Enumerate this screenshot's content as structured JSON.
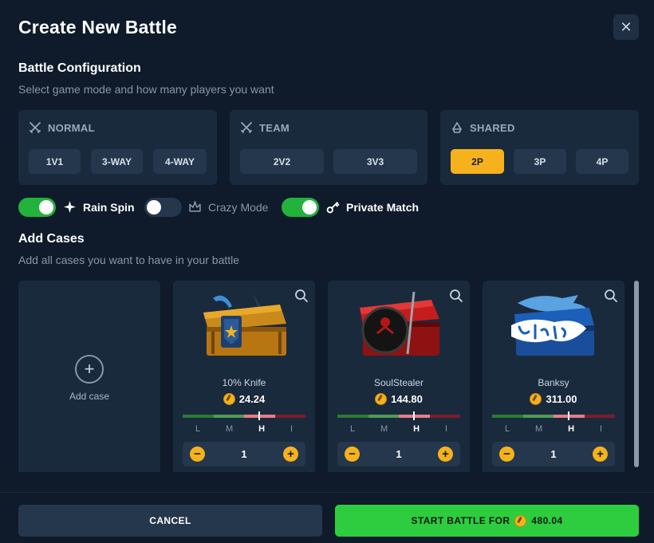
{
  "title": "Create New Battle",
  "config": {
    "heading": "Battle Configuration",
    "subheading": "Select game mode and how many players you want"
  },
  "modes": {
    "normal": {
      "label": "NORMAL",
      "icon": "crossed-swords-icon",
      "options": [
        "1V1",
        "3-WAY",
        "4-WAY"
      ]
    },
    "team": {
      "label": "TEAM",
      "icon": "crossed-swords-icon",
      "options": [
        "2V2",
        "3V3"
      ]
    },
    "shared": {
      "label": "SHARED",
      "icon": "recycle-icon",
      "options": [
        "2P",
        "3P",
        "4P"
      ],
      "selected": "2P"
    }
  },
  "toggles": {
    "rain_spin": {
      "label": "Rain Spin",
      "on": true,
      "icon": "sparkle-icon"
    },
    "crazy_mode": {
      "label": "Crazy Mode",
      "on": false,
      "icon": "crown-icon"
    },
    "private_match": {
      "label": "Private Match",
      "on": true,
      "icon": "key-icon"
    }
  },
  "cases_section": {
    "heading": "Add Cases",
    "subheading": "Add all cases you want to have in your battle",
    "add_label": "Add case"
  },
  "cases": [
    {
      "name": "10% Knife",
      "price": "24.24",
      "risk": "H",
      "quantity": "1"
    },
    {
      "name": "SoulStealer",
      "price": "144.80",
      "risk": "H",
      "quantity": "1"
    },
    {
      "name": "Banksy",
      "price": "311.00",
      "risk": "H",
      "quantity": "1"
    }
  ],
  "risk_levels": [
    "L",
    "M",
    "H",
    "I"
  ],
  "footer": {
    "cancel_label": "CANCEL",
    "start_label": "START BATTLE FOR",
    "start_total": "480.04"
  },
  "colors": {
    "accent": "#f5b21d",
    "success": "#2ecc3f",
    "background": "#0f1b2a",
    "panel": "#1a2a3d"
  }
}
